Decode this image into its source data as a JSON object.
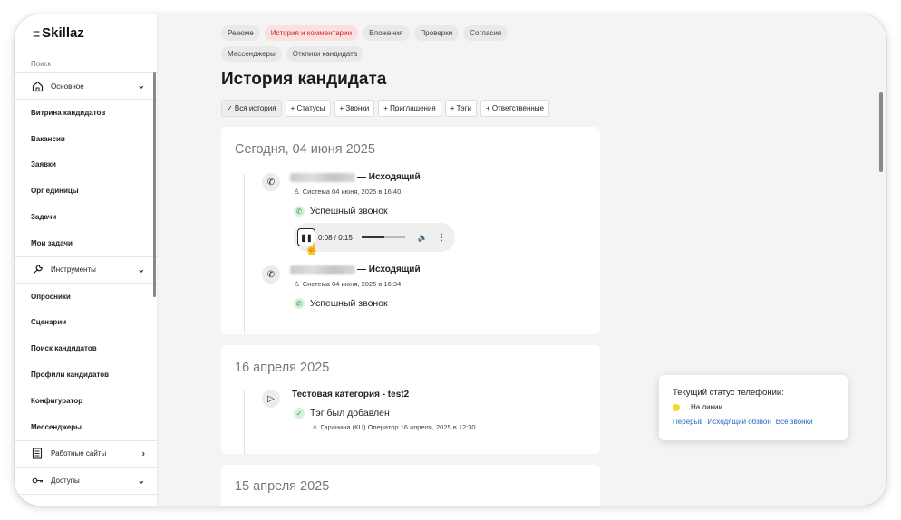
{
  "app": {
    "name": "Skillaz"
  },
  "sidebar": {
    "search_label": "Поиск",
    "groups": {
      "main": "Основное",
      "tools": "Инструменты",
      "job_sites": "Работные сайты",
      "access": "Доступы"
    },
    "items": [
      "Витрина кандидатов",
      "Вакансии",
      "Заявки",
      "Орг единицы",
      "Задачи",
      "Мои задачи",
      "Опросники",
      "Сценарии",
      "Поиск кандидатов",
      "Профили кандидатов",
      "Конфигуратор",
      "Мессенджеры"
    ]
  },
  "tabs": [
    "Резюме",
    "История и комментарии",
    "Вложения",
    "Проверки",
    "Согласия",
    "Мессенджеры",
    "Отклики кандидата"
  ],
  "active_tab": "История и комментарии",
  "page": {
    "title": "История кандидата"
  },
  "filters": [
    "✓ Вся история",
    "+ Статусы",
    "+ Звонки",
    "+ Приглашения",
    "+ Тэги",
    "+ Ответственные"
  ],
  "sections": [
    {
      "date": "Сегодня, 04 июня 2025",
      "events": [
        {
          "title": "— Исходящий",
          "meta": "Система 04 июня, 2025 в 16:40",
          "status": "Успешный звонок",
          "player": {
            "time": "0:08 / 0:15",
            "progress": 0.53
          }
        },
        {
          "title": "— Исходящий",
          "meta": "Система 04 июня, 2025 в 16:34",
          "status": "Успешный звонок"
        }
      ]
    },
    {
      "date": "16 апреля 2025",
      "events": [
        {
          "title": "Тестовая категория - test2",
          "status": "Тэг был добавлен",
          "meta": "Гаранина (КЦ) Оператор 16 апреля, 2025 в 12:30"
        }
      ]
    },
    {
      "date": "15 апреля 2025"
    }
  ],
  "telephony": {
    "title": "Текущий статус телефонии:",
    "status": "На линии",
    "status_color": "#f3d633",
    "links": [
      "Перерыв",
      "Исходящий обзвон",
      "Все звонки"
    ]
  },
  "colors": {
    "accent": "#d3262b",
    "link": "#2a66c9",
    "success": "#2c9b47"
  }
}
